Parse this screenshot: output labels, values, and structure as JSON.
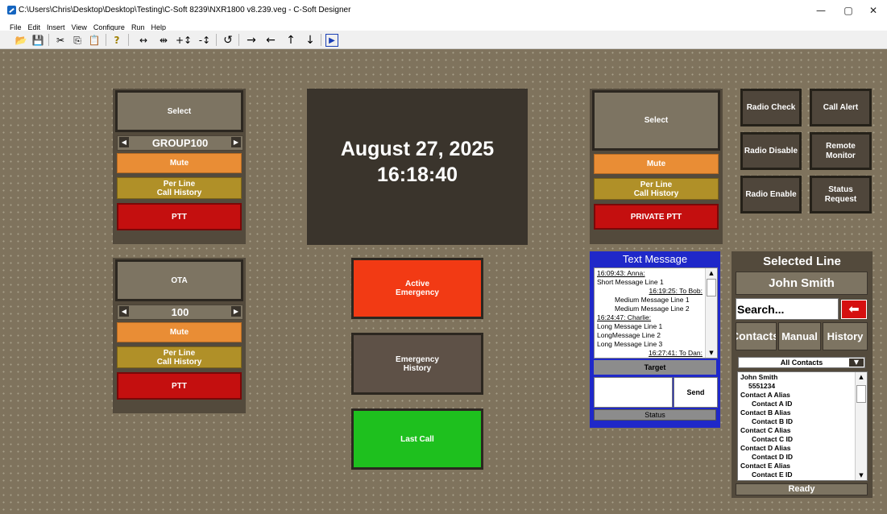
{
  "window": {
    "title": "C:\\Users\\Chris\\Desktop\\Desktop\\Testing\\C-Soft 8239\\NXR1800 v8.239.veg - C-Soft Designer",
    "minimize": "—",
    "maximize": "▢",
    "close": "✕"
  },
  "menu": [
    "File",
    "Edit",
    "Insert",
    "View",
    "Configure",
    "Run",
    "Help"
  ],
  "toolbar": {
    "icons": [
      "open-icon",
      "save-icon",
      "cut-icon",
      "copy-icon",
      "paste-icon",
      "help-icon",
      "align-horizontal-icon",
      "space-horizontal-icon",
      "increase-vertical-icon",
      "decrease-vertical-icon",
      "rotate-icon",
      "arrow-right-icon",
      "arrow-left-icon",
      "arrow-up-icon",
      "arrow-down-icon",
      "run-icon"
    ],
    "glyphs": [
      "📂",
      "💾",
      "✂",
      "⎘",
      "📋",
      "?",
      "↔",
      "⇹",
      "+↕",
      "-↕",
      "↺",
      "→",
      "←",
      "↑",
      "↓",
      "▶"
    ]
  },
  "left_panel_top": {
    "select": "Select",
    "group": "GROUP100",
    "prev": "◀",
    "next": "▶",
    "mute": "Mute",
    "history_1": "Per Line",
    "history_2": "Call History",
    "ptt": "PTT"
  },
  "left_panel_bottom": {
    "select": "OTA",
    "group": "100",
    "prev": "◀",
    "next": "▶",
    "mute": "Mute",
    "history_1": "Per Line",
    "history_2": "Call History",
    "ptt": "PTT"
  },
  "clock": {
    "date": "August 27, 2025",
    "time": "16:18:40"
  },
  "center_buttons": {
    "active_emergency_1": "Active",
    "active_emergency_2": "Emergency",
    "emergency_history_1": "Emergency",
    "emergency_history_2": "History",
    "last_call": "Last Call"
  },
  "right_panel": {
    "select": "Select",
    "mute": "Mute",
    "history_1": "Per Line",
    "history_2": "Call History",
    "ptt": "PRIVATE PTT"
  },
  "functions": {
    "radio_check": "Radio Check",
    "call_alert": "Call Alert",
    "radio_disable": "Radio Disable",
    "remote_monitor_1": "Remote",
    "remote_monitor_2": "Monitor",
    "radio_enable": "Radio Enable",
    "status_request_1": "Status",
    "status_request_2": "Request"
  },
  "text_message": {
    "title": "Text Message",
    "messages": [
      {
        "text": "16:09:43: Anna:",
        "style": "header-left"
      },
      {
        "text": "Short Message Line 1",
        "style": "left"
      },
      {
        "text": "16:19:25: To Bob:",
        "style": "header-right"
      },
      {
        "text": "Medium Message Line 1",
        "style": "indent"
      },
      {
        "text": "Medium Message Line 2",
        "style": "indent"
      },
      {
        "text": "16:24:47: Charlie:",
        "style": "header-left"
      },
      {
        "text": "Long Message Line 1",
        "style": "left"
      },
      {
        "text": "LongMessage Line 2",
        "style": "left"
      },
      {
        "text": "Long Message Line 3",
        "style": "left"
      },
      {
        "text": "16:27:41: To Dan:",
        "style": "header-right"
      }
    ],
    "target": "Target",
    "send": "Send",
    "status": "Status"
  },
  "selected_line": {
    "title": "Selected Line",
    "name": "John Smith",
    "search_placeholder": "Search...",
    "back": "⬅",
    "tabs": [
      "Contacts",
      "Manual",
      "History"
    ],
    "filter": "All Contacts",
    "filter_arrow": "▼",
    "contacts": [
      {
        "alias": "John Smith",
        "id": "5551234"
      },
      {
        "alias": "Contact A Alias",
        "id": "Contact A ID"
      },
      {
        "alias": "Contact B Alias",
        "id": "Contact B ID"
      },
      {
        "alias": "Contact C Alias",
        "id": "Contact C ID"
      },
      {
        "alias": "Contact D Alias",
        "id": "Contact D ID"
      },
      {
        "alias": "Contact E Alias",
        "id": "Contact E ID"
      }
    ],
    "status": "Ready"
  },
  "colors": {
    "canvas": "#7f735d",
    "panel": "#534a3c",
    "mute": "#e98d35",
    "history": "#b09028",
    "ptt": "#c40f0f",
    "active_emergency": "#f23a14",
    "emergency_history": "#5e5147",
    "last_call": "#1ec01e",
    "text_message_frame": "#1f28c9"
  }
}
